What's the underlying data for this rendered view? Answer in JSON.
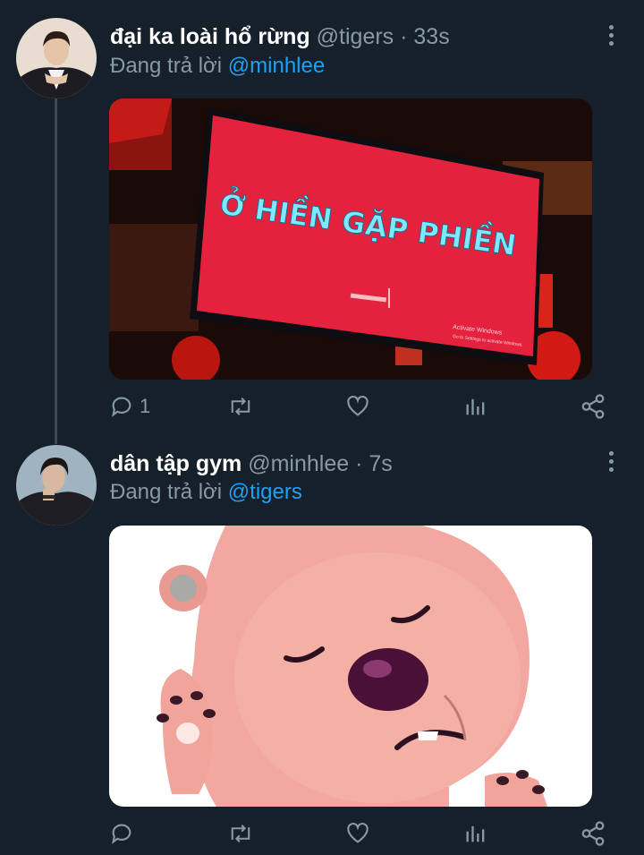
{
  "tweets": [
    {
      "name": "đại ka loài hổ rừng",
      "handle": "@tigers",
      "separator": "·",
      "time": "33s",
      "reply_prefix": "Đang trả lời",
      "reply_mention": "@minhlee",
      "image_text": "Ở HIỀN GẶP PHIỀN",
      "watermark_line1": "Activate Windows",
      "watermark_line2": "Go to Settings to activate Windows.",
      "reply_count": "1",
      "retweet_count": "",
      "like_count": ""
    },
    {
      "name": "dân tập gym",
      "handle": "@minhlee",
      "separator": "·",
      "time": "7s",
      "reply_prefix": "Đang trả lời",
      "reply_mention": "@tigers",
      "reply_count": "",
      "retweet_count": "",
      "like_count": ""
    }
  ],
  "icons": [
    "reply-icon",
    "retweet-icon",
    "like-icon",
    "analytics-icon",
    "share-icon",
    "more-icon"
  ],
  "colors": {
    "background": "#15202b",
    "secondary_text": "#8899a6",
    "link": "#1da1f2",
    "thread_line": "#3d4b57"
  }
}
